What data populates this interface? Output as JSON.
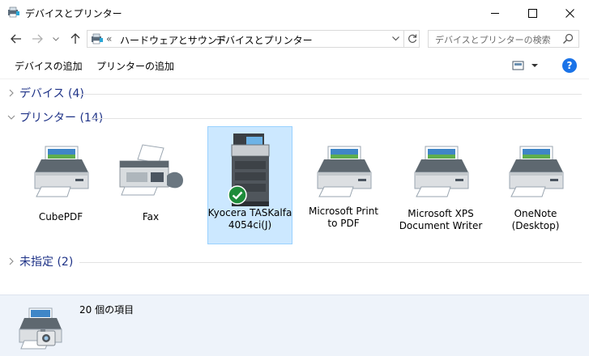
{
  "window": {
    "title": "デバイスとプリンター"
  },
  "nav": {
    "address_overflow": "«",
    "breadcrumb": [
      "ハードウェアとサウンド",
      "デバイスとプリンター"
    ],
    "search_placeholder": "デバイスとプリンターの検索"
  },
  "toolbar": {
    "add_device": "デバイスの追加",
    "add_printer": "プリンターの追加",
    "help": "?"
  },
  "groups": {
    "devices": "デバイス (4)",
    "printers": "プリンター (14)",
    "unspecified": "未指定 (2)"
  },
  "printers": [
    {
      "label": "CubePDF",
      "icon": "printer-icon"
    },
    {
      "label": "Fax",
      "icon": "fax-icon"
    },
    {
      "label": "Kyocera TASKalfa\n4054ci(J)",
      "icon": "multifunction-printer-icon",
      "default": true,
      "selected": true
    },
    {
      "label": "Microsoft Print\nto PDF",
      "icon": "printer-icon"
    },
    {
      "label": "Microsoft XPS\nDocument Writer",
      "icon": "printer-icon"
    },
    {
      "label": "OneNote\n(Desktop)",
      "icon": "printer-icon"
    }
  ],
  "details": {
    "count_text": "20 個の項目"
  },
  "colors": {
    "group_header": "#1e3287",
    "selection": "#cce8ff",
    "details_bg": "#eef3fa",
    "default_check": "#1e8c3a",
    "help": "#1a73e8"
  }
}
